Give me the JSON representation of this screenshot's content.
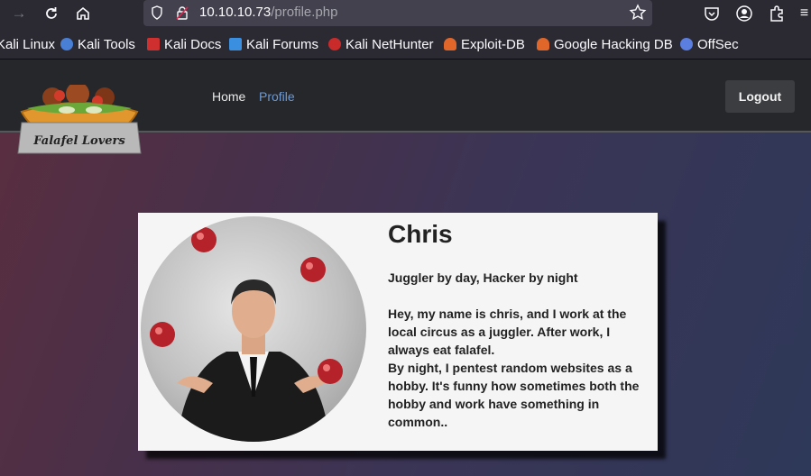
{
  "browser": {
    "url_host": "10.10.10.73",
    "url_path": "/profile.php"
  },
  "bookmarks": [
    {
      "label": "Kali Linux",
      "icon": "kali-icon",
      "color": "#2f7dd6"
    },
    {
      "label": "Kali Tools",
      "icon": "kali-tools-icon",
      "color": "#4a7fd6"
    },
    {
      "label": "Kali Docs",
      "icon": "kali-docs-icon",
      "color": "#d02f2f"
    },
    {
      "label": "Kali Forums",
      "icon": "kali-forums-icon",
      "color": "#3b8fe0"
    },
    {
      "label": "Kali NetHunter",
      "icon": "nethunter-icon",
      "color": "#c92a2a"
    },
    {
      "label": "Exploit-DB",
      "icon": "exploit-db-icon",
      "color": "#e0662a"
    },
    {
      "label": "Google Hacking DB",
      "icon": "ghdb-icon",
      "color": "#e0662a"
    },
    {
      "label": "OffSec",
      "icon": "offsec-icon",
      "color": "#5b7fe0"
    }
  ],
  "site": {
    "logo_text": "Falafel Lovers",
    "nav": {
      "home": "Home",
      "profile": "Profile"
    },
    "logout": "Logout"
  },
  "profile": {
    "name": "Chris",
    "tagline": "Juggler by day, Hacker by night",
    "bio_1": "Hey, my name is chris, and I work at the local circus as a juggler. After work, I always eat falafel.",
    "bio_2": "By night, I pentest random websites as a hobby. It's funny how sometimes both the hobby and work have something in common.."
  }
}
